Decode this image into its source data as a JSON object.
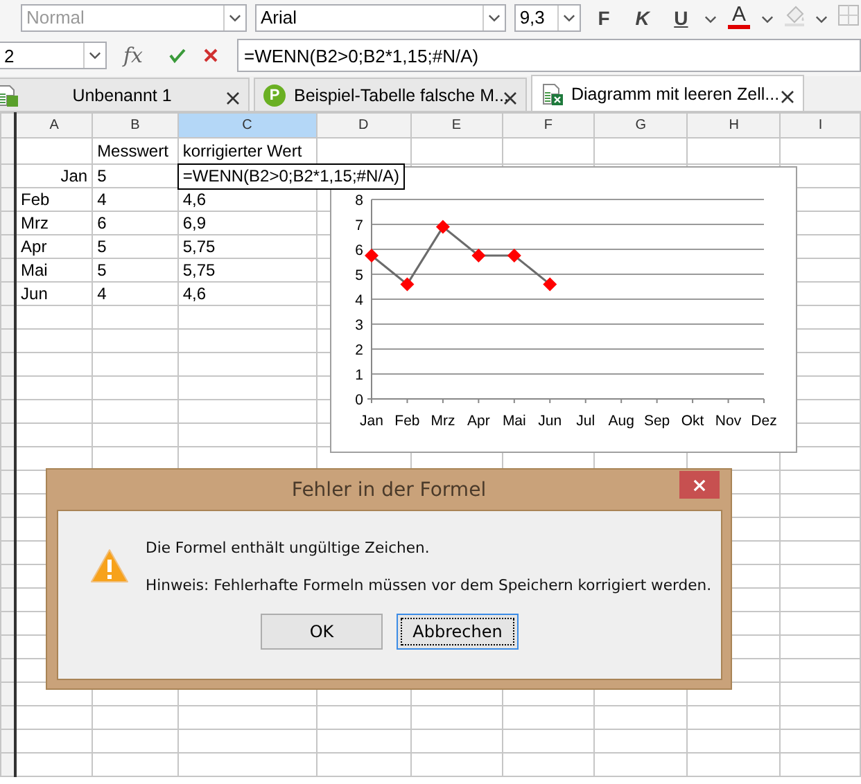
{
  "toolbar": {
    "style_box": {
      "value": "Normal",
      "disabled": true
    },
    "font_box": {
      "value": "Arial"
    },
    "size_box": {
      "value": "9,3"
    },
    "format_buttons": [
      {
        "label": "F",
        "kind": "bold"
      },
      {
        "label": "K",
        "kind": "italic"
      },
      {
        "label": "U",
        "kind": "underline"
      }
    ],
    "font_color_button": {
      "label": "A",
      "color": "#e00000"
    }
  },
  "formula_bar": {
    "name_box": {
      "value": "2"
    },
    "function_button": {
      "label": "fx"
    },
    "formula": {
      "value": "=WENN(B2>0;B2*1,15;#N/A)"
    }
  },
  "tabs": [
    {
      "label": "Unbenannt 1",
      "kind": "sheet",
      "selected": false
    },
    {
      "label": "Beispiel-Tabelle falsche M...",
      "kind": "badge",
      "icon_letter": "P",
      "selected": false
    },
    {
      "label": "Diagramm mit leeren Zell...",
      "kind": "excel",
      "selected": true
    }
  ],
  "sheet": {
    "columns": [
      {
        "label": "A",
        "selected": false
      },
      {
        "label": "B",
        "selected": false
      },
      {
        "label": "C",
        "selected": true
      },
      {
        "label": "D",
        "selected": false
      },
      {
        "label": "E",
        "selected": false
      },
      {
        "label": "F",
        "selected": false
      },
      {
        "label": "G",
        "selected": false
      },
      {
        "label": "H",
        "selected": false
      },
      {
        "label": "I",
        "selected": false
      }
    ],
    "rows": [
      {
        "cells": [
          {
            "text": ""
          },
          {
            "text": "Messwert"
          },
          {
            "text": "korrigierter Wert"
          }
        ]
      },
      {
        "cells": [
          {
            "text": "Jan",
            "kind": "date"
          },
          {
            "text": "5"
          },
          {
            "text": "=WENN(B2>0;B2*1,15;#N/A)",
            "editing": true
          }
        ]
      },
      {
        "cells": [
          {
            "text": "Feb"
          },
          {
            "text": "4"
          },
          {
            "text": "4,6"
          }
        ]
      },
      {
        "cells": [
          {
            "text": "Mrz"
          },
          {
            "text": "6"
          },
          {
            "text": "6,9"
          }
        ]
      },
      {
        "cells": [
          {
            "text": "Apr"
          },
          {
            "text": "5"
          },
          {
            "text": "5,75"
          }
        ]
      },
      {
        "cells": [
          {
            "text": "Mai"
          },
          {
            "text": "5"
          },
          {
            "text": "5,75"
          }
        ]
      },
      {
        "cells": [
          {
            "text": "Jun"
          },
          {
            "text": "4"
          },
          {
            "text": "4,6"
          }
        ]
      }
    ]
  },
  "chart": {
    "chart_data": {
      "type": "line",
      "grid": true,
      "categories": [
        "Jan",
        "Feb",
        "Mrz",
        "Apr",
        "Mai",
        "Jun",
        "Jul",
        "Aug",
        "Sep",
        "Okt",
        "Nov",
        "Dez"
      ],
      "series": [
        {
          "color": "#ff0000",
          "marker": "diamond",
          "values": [
            5.75,
            4.6,
            6.9,
            5.75,
            5.75,
            4.6,
            null,
            null,
            null,
            null,
            null,
            null
          ]
        }
      ],
      "ylim": [
        0,
        8
      ],
      "yticks": [
        0,
        1,
        2,
        3,
        4,
        5,
        6,
        7,
        8
      ]
    }
  },
  "dialog": {
    "title": "Fehler in der Formel",
    "messages": [
      "Die Formel enthält ungültige Zeichen.",
      "Hinweis: Fehlerhafte Formeln müssen vor dem Speichern korrigiert werden."
    ],
    "buttons": [
      {
        "label": "OK",
        "focused": false
      },
      {
        "label": "Abbrechen",
        "focused": true
      }
    ]
  }
}
